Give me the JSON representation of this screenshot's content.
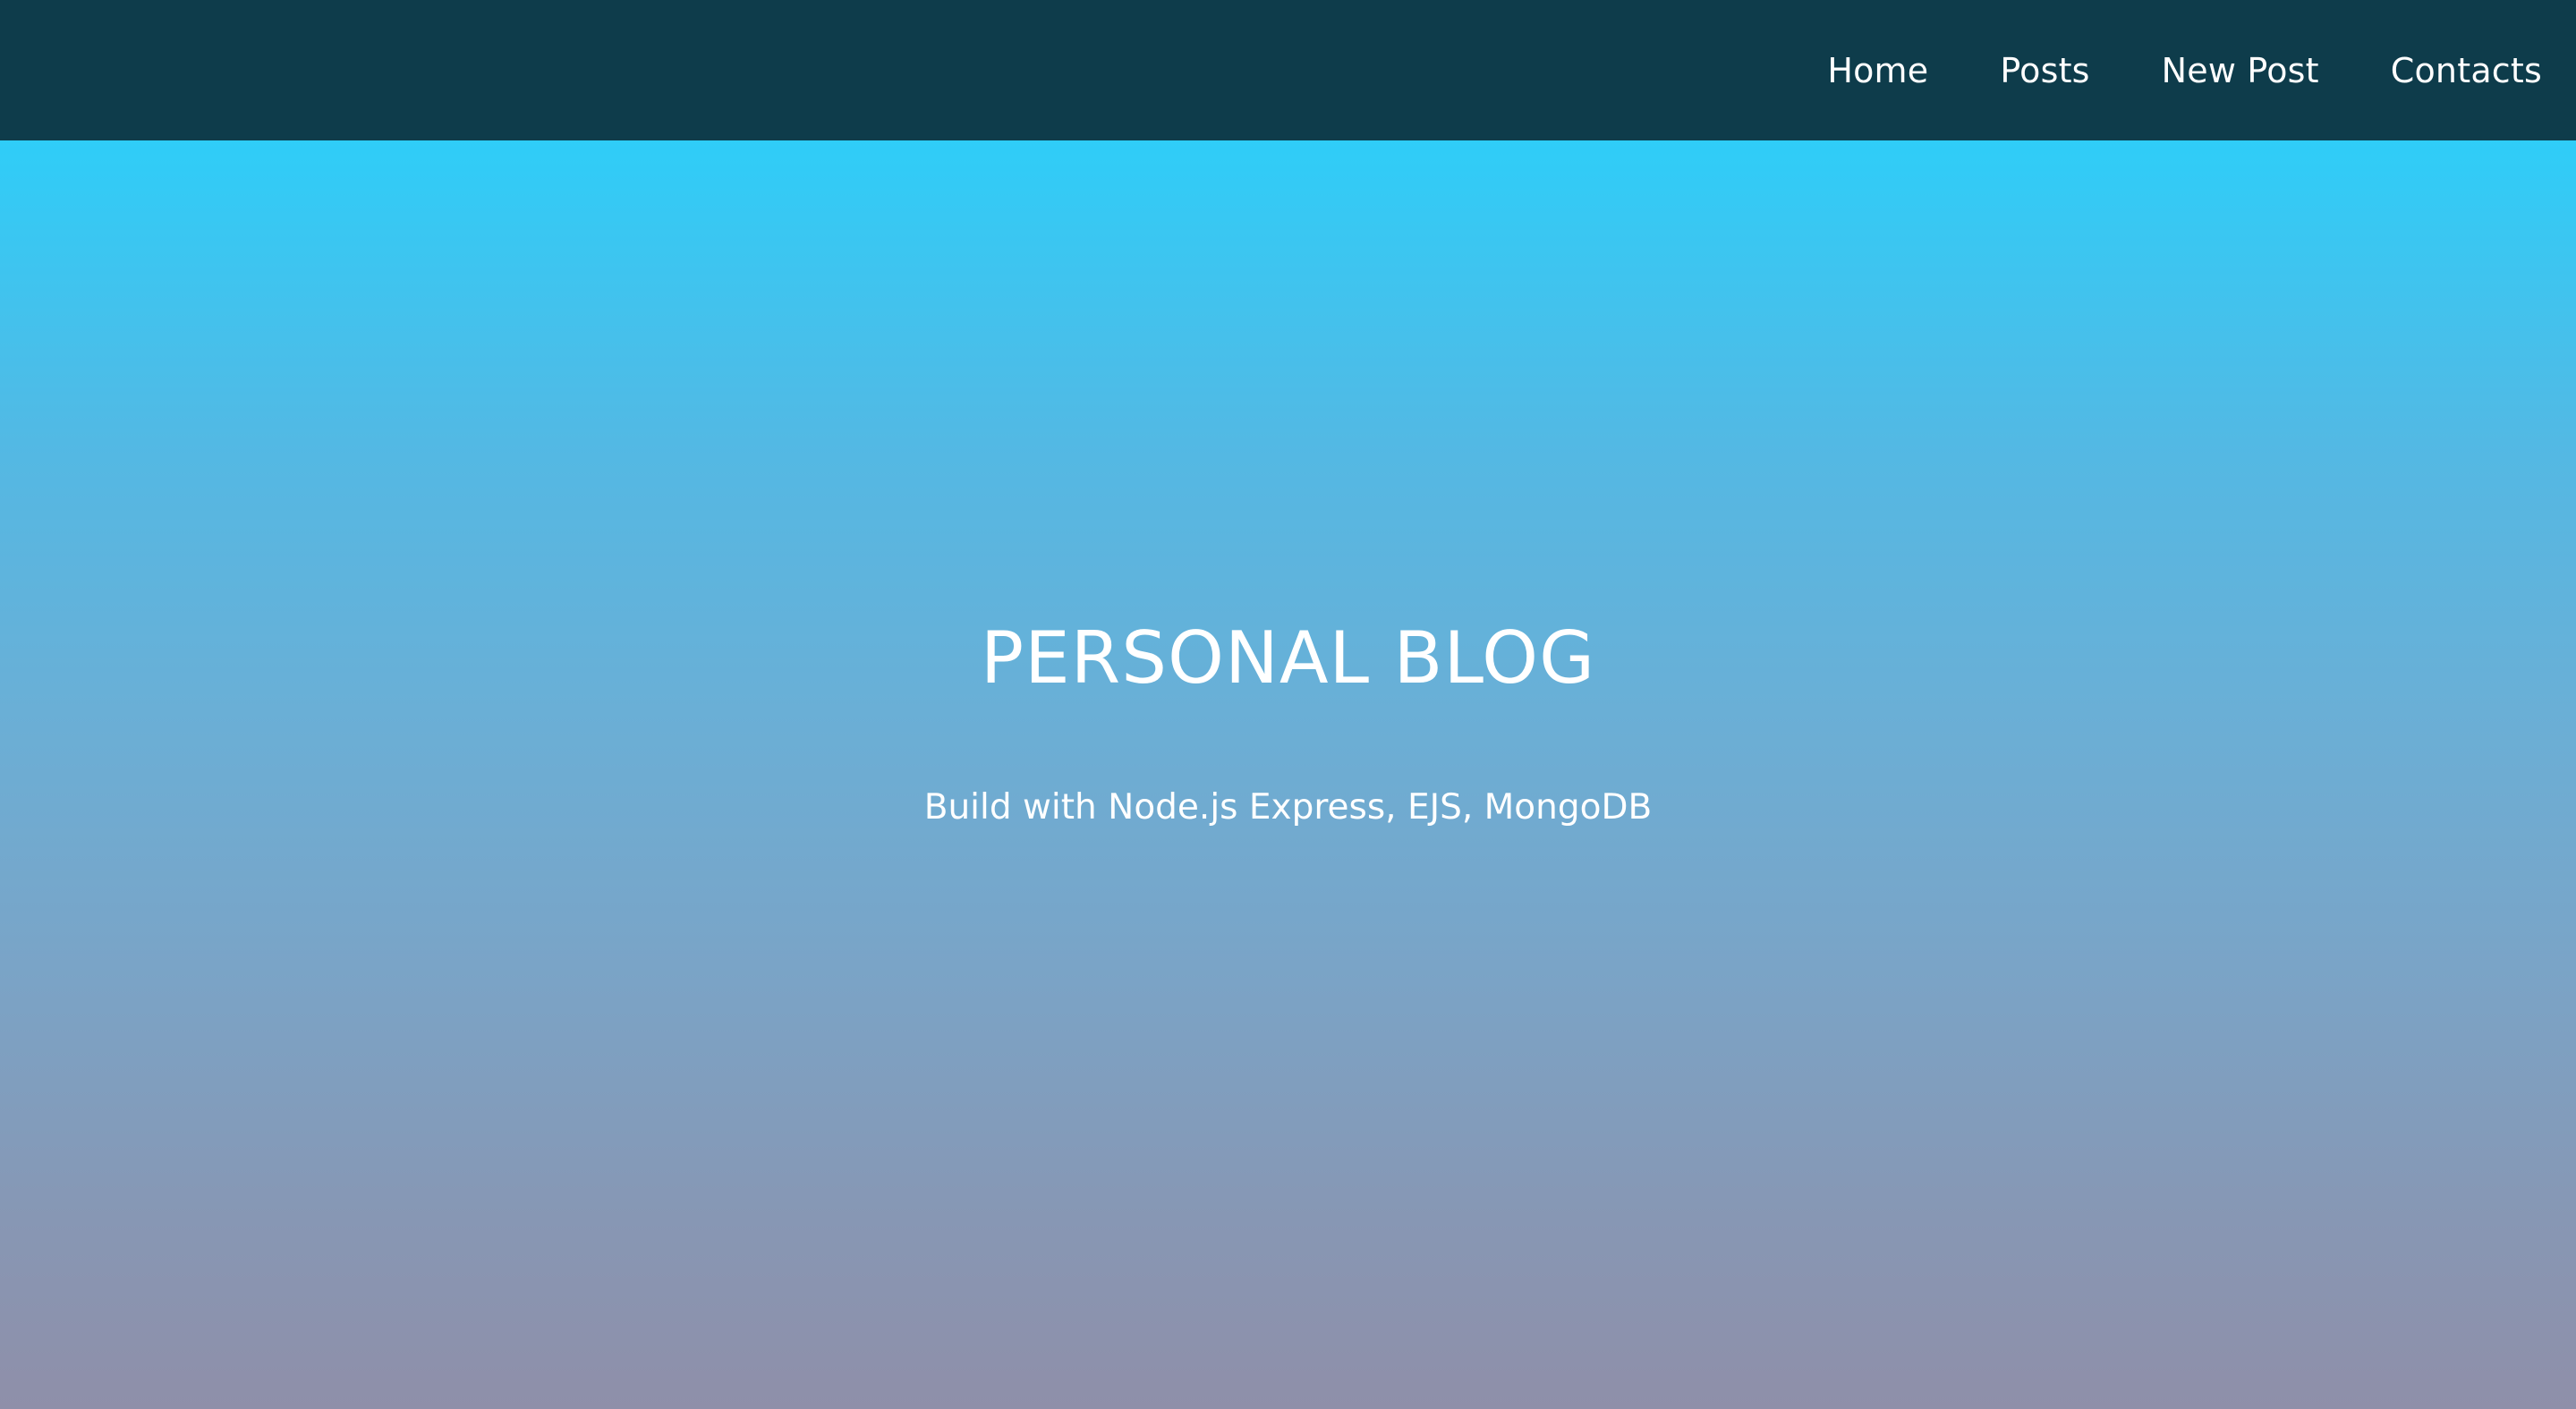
{
  "nav": {
    "items": [
      {
        "label": "Home"
      },
      {
        "label": "Posts"
      },
      {
        "label": "New Post"
      },
      {
        "label": "Contacts"
      }
    ]
  },
  "hero": {
    "title": "PERSONAL BLOG",
    "subtitle": "Build with Node.js Express, EJS, MongoDB"
  },
  "colors": {
    "navbar_background": "#0e3c4b",
    "hero_gradient_top": "#2fcdf8",
    "hero_gradient_bottom": "#8f8fa9",
    "text": "#ffffff"
  }
}
